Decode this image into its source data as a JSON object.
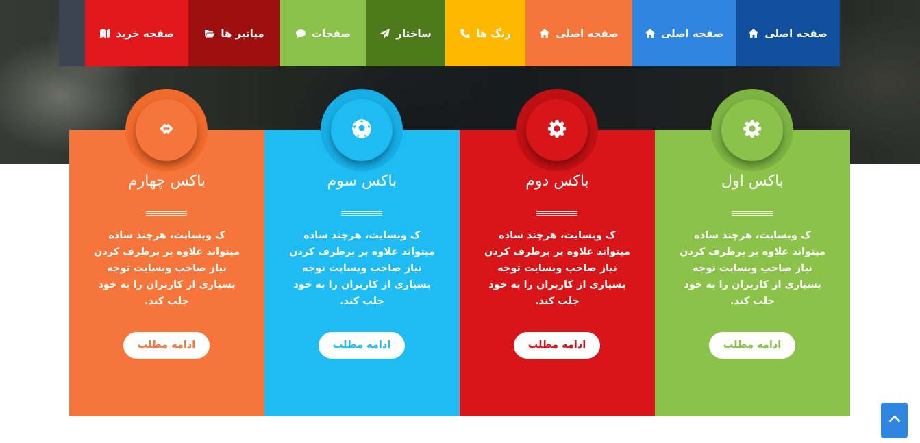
{
  "nav": {
    "items": [
      {
        "label": "صفحه اصلی",
        "icon": "home-icon",
        "color": "#0f4f9e"
      },
      {
        "label": "صفحه اصلی",
        "icon": "home-icon",
        "color": "#2f86e0"
      },
      {
        "label": "صفحه اصلی",
        "icon": "home-icon",
        "color": "#f5753b"
      },
      {
        "label": "رنگ ها",
        "icon": "phone-icon",
        "color": "#ffb800"
      },
      {
        "label": "ساختار",
        "icon": "paper-plane-icon",
        "color": "#4f7a1c"
      },
      {
        "label": "صفحات",
        "icon": "comment-icon",
        "color": "#8bc34a"
      },
      {
        "label": "میانبر ها",
        "icon": "folder-open-icon",
        "color": "#9e1010"
      },
      {
        "label": "صفحه خرید",
        "icon": "map-icon",
        "color": "#e0181b"
      }
    ]
  },
  "boxes": [
    {
      "title": "باکس اول",
      "icon": "gear-icon",
      "color": "#8bc34a",
      "circle_outer": "#7cb342",
      "circle_inner": "#8bc34a",
      "text": "ک وبسایت، هرچند ساده میتواند علاوه بر برطرف کردن نیاز صاحب وبسایت توجه بسیاری از کاربران را به خود جلب کند.",
      "button": "ادامه مطلب"
    },
    {
      "title": "باکس دوم",
      "icon": "gear-icon",
      "color": "#d81518",
      "circle_outer": "#c01014",
      "circle_inner": "#d81518",
      "text": "ک وبسایت، هرچند ساده میتواند علاوه بر برطرف کردن نیاز صاحب وبسایت توجه بسیاری از کاربران را به خود جلب کند.",
      "button": "ادامه مطلب"
    },
    {
      "title": "باکس سوم",
      "icon": "soccer-ball-icon",
      "color": "#1ebcf2",
      "circle_outer": "#17aee6",
      "circle_inner": "#1ebcf2",
      "text": "ک وبسایت، هرچند ساده میتواند علاوه بر برطرف کردن نیاز صاحب وبسایت توجه بسیاری از کاربران را به خود جلب کند.",
      "button": "ادامه مطلب"
    },
    {
      "title": "باکس چهارم",
      "icon": "link-icon",
      "color": "#f5753b",
      "circle_outer": "#f06a2c",
      "circle_inner": "#f5753b",
      "text": "ک وبسایت، هرچند ساده میتواند علاوه بر برطرف کردن نیاز صاحب وبسایت توجه بسیاری از کاربران را به خود جلب کند.",
      "button": "ادامه مطلب"
    }
  ],
  "back_to_top": {
    "icon": "chevron-up-icon",
    "color": "#2f86e0"
  }
}
